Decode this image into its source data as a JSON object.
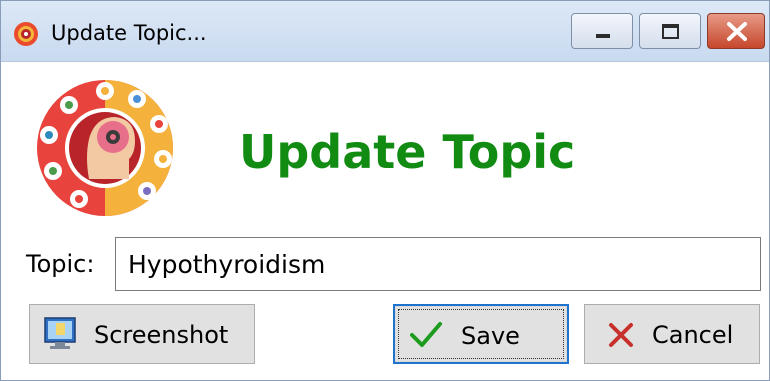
{
  "window": {
    "title": "Update Topic..."
  },
  "heading": "Update Topic",
  "form": {
    "topic_label": "Topic:",
    "topic_value": "Hypothyroidism"
  },
  "buttons": {
    "screenshot": "Screenshot",
    "save": "Save",
    "cancel": "Cancel"
  },
  "colors": {
    "heading": "#128b12",
    "titlebar": "#c9daf0",
    "close": "#c6472c",
    "save_focus": "#1f73cc"
  },
  "icons": {
    "app": "brain-gear-icon",
    "logo": "head-brain-gear-logo",
    "screenshot": "monitor-icon",
    "save": "checkmark-icon",
    "cancel": "x-icon"
  }
}
